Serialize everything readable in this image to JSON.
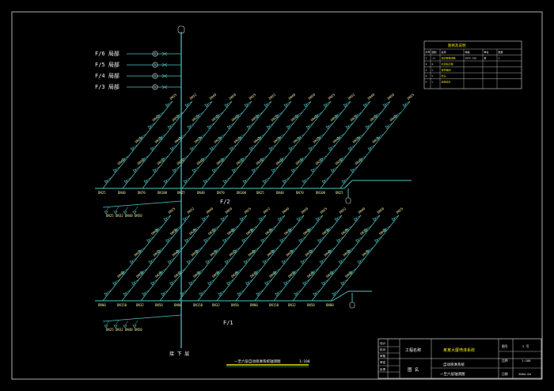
{
  "drawing": {
    "floor_labels": [
      "F/6 局部",
      "F/5 局部",
      "F/4 局部",
      "F/3 局部"
    ],
    "floor_circle_text": "①",
    "level_f2": "F/2",
    "level_f1": "F/1",
    "basement": "接 下 层",
    "subtitle": "一至六层自动喷淋系统轴测图",
    "subtitle_scale": "1:100",
    "pipe_sizes": [
      "DN25",
      "DN32",
      "DN40",
      "DN50",
      "DN70",
      "DN80",
      "DN100",
      "DN150"
    ]
  },
  "legend": {
    "title": "图例及说明",
    "headers": [
      "序号",
      "图例",
      "名称",
      "规格",
      "单位",
      "数量"
    ],
    "rows": [
      [
        "1",
        "—◯—",
        "湿式报警阀组",
        "ZSFZ-150",
        "套",
        "1"
      ],
      [
        "2",
        "⊗",
        "水流指示器",
        "",
        "",
        ""
      ],
      [
        "3",
        "⊙",
        "信号蝶阀",
        "",
        "",
        ""
      ],
      [
        "4",
        "▽",
        "喷头",
        "",
        "",
        ""
      ],
      [
        "5",
        "◇",
        "末端试水",
        "",
        "",
        ""
      ]
    ]
  },
  "title_block": {
    "project_label": "工程名称",
    "project_name": "某某大厦喷淋系统",
    "sheet_label": "图  名",
    "sheet_name_1": "自动喷淋系统",
    "sheet_name_2": "一至六层轴测图",
    "drawing_no_label": "图号",
    "drawing_no": "2 号",
    "scale_label": "比例",
    "scale": "1:100",
    "date_label": "日期",
    "date": "2004-04",
    "sign_labels": [
      "设计",
      "校对",
      "审核",
      "审定",
      "负责"
    ]
  },
  "colors": {
    "background": "#000000",
    "pipe": "#4fc3c3",
    "dimension_text": "#e8e6a0",
    "annotation": "#f2f2f2",
    "frame": "#d8d8d8",
    "accent": "#e8e000"
  }
}
